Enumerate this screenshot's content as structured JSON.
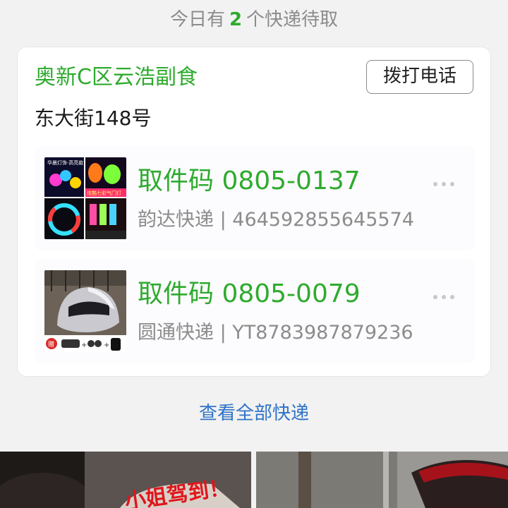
{
  "summary": {
    "prefix": "今日有",
    "count": "2",
    "suffix": "个快递待取"
  },
  "station": {
    "name": "奥新C区云浩副食",
    "call_label": "拨打电话",
    "address": "东大街148号"
  },
  "parcels": [
    {
      "code": "取件码 0805-0137",
      "courier": "韵达快递 | 464592855645574",
      "image_texts": [
        "华晨灯饰·高亮款",
        "炫酷七彩气门灯"
      ]
    },
    {
      "code": "取件码 0805-0079",
      "courier": "圆通快递 | YT8783987879236",
      "image_texts": [
        "赠"
      ]
    }
  ],
  "view_all": "查看全部快递",
  "feed": [
    {
      "caption": "小姐驾到！"
    },
    {
      "caption": ""
    }
  ],
  "colors": {
    "accent_green": "#2eab2e",
    "link_blue": "#2f73c8",
    "muted": "#8c8c8c"
  },
  "icons": {
    "more": "more-dots-icon"
  }
}
